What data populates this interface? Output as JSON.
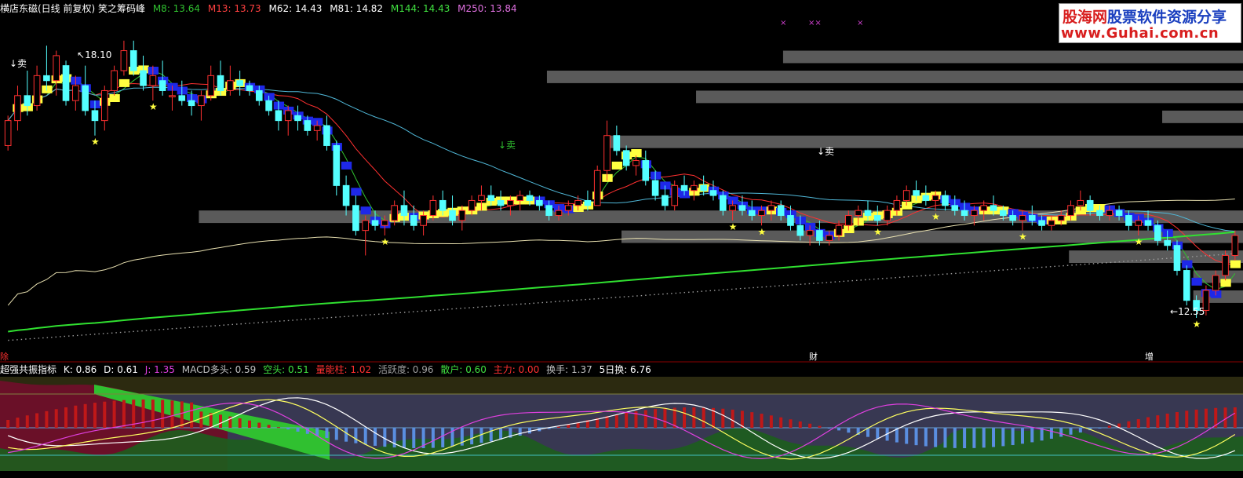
{
  "header": {
    "title": "横店东磁(日线 前复权) 笑之筹码峰",
    "ma": [
      {
        "label": "M8: 13.64",
        "color": "#30c030"
      },
      {
        "label": "M13: 13.73",
        "color": "#ff4040"
      },
      {
        "label": "M62: 14.43",
        "color": "#ffffff"
      },
      {
        "label": "M81: 14.82",
        "color": "#ffffff"
      },
      {
        "label": "M144: 14.43",
        "color": "#40e040"
      },
      {
        "label": "M250: 13.84",
        "color": "#e070e0"
      }
    ]
  },
  "indicator_header": {
    "name": "超强共振指标",
    "items": [
      {
        "label": "K: 0.86",
        "color": "#ffffff"
      },
      {
        "label": "D: 0.61",
        "color": "#ffffff"
      },
      {
        "label": "J: 1.35",
        "color": "#e040e0"
      },
      {
        "label": "MACD多头: 0.59",
        "color": "#c0c0c0"
      },
      {
        "label": "空头: 0.51",
        "color": "#40e040"
      },
      {
        "label": "量能柱: 1.02",
        "color": "#ff3030"
      },
      {
        "label": "活跃度: 0.96",
        "color": "#a0a0a0"
      },
      {
        "label": "散户: 0.60",
        "color": "#40e040"
      },
      {
        "label": "主力: 0.00",
        "color": "#ff3030"
      },
      {
        "label": "换手: 1.37",
        "color": "#c0c0c0"
      },
      {
        "label": "5日换: 6.76",
        "color": "#ffffff"
      }
    ]
  },
  "logo": {
    "line1_a": "股海网",
    "line1_b": "股票软件资源分享",
    "line2": "www.Guhai.com.cn"
  },
  "annotations": {
    "high": "18.10",
    "low": "12.55",
    "sell1": "↓卖",
    "sell2": "↓卖",
    "sell3": "↓卖",
    "event1": "财",
    "event2": "增",
    "event0": "除"
  },
  "colors": {
    "up": "#ff3030",
    "down": "#54ffff",
    "bg": "#000000",
    "divider": "#8b0000"
  },
  "chart_data": {
    "type": "candlestick",
    "title": "横店东磁(日线 前复权)",
    "ylim": [
      12.0,
      18.6
    ],
    "high_label": 18.1,
    "low_label": 12.55,
    "ohlc": [
      [
        16.0,
        16.6,
        15.9,
        16.5
      ],
      [
        16.5,
        17.2,
        16.3,
        17.0
      ],
      [
        17.0,
        17.5,
        16.6,
        16.8
      ],
      [
        16.8,
        17.6,
        16.7,
        17.4
      ],
      [
        17.4,
        18.0,
        17.1,
        17.3
      ],
      [
        17.3,
        17.9,
        17.0,
        17.8
      ],
      [
        17.6,
        17.7,
        16.8,
        16.9
      ],
      [
        16.9,
        17.4,
        16.7,
        17.2
      ],
      [
        17.2,
        17.6,
        16.6,
        16.7
      ],
      [
        16.7,
        16.9,
        16.2,
        16.5
      ],
      [
        16.5,
        17.2,
        16.3,
        17.1
      ],
      [
        17.1,
        17.6,
        17.0,
        17.5
      ],
      [
        17.5,
        18.1,
        17.4,
        17.9
      ],
      [
        17.9,
        18.1,
        17.4,
        17.5
      ],
      [
        17.5,
        17.8,
        17.1,
        17.2
      ],
      [
        17.2,
        17.6,
        16.9,
        17.4
      ],
      [
        17.3,
        17.7,
        17.0,
        17.1
      ],
      [
        17.0,
        17.2,
        16.7,
        17.0
      ],
      [
        17.0,
        17.3,
        16.8,
        16.9
      ],
      [
        16.9,
        17.1,
        16.6,
        16.8
      ],
      [
        16.8,
        17.1,
        16.5,
        17.0
      ],
      [
        17.0,
        17.6,
        16.9,
        17.4
      ],
      [
        17.4,
        17.7,
        17.0,
        17.1
      ],
      [
        17.1,
        17.6,
        17.0,
        17.3
      ],
      [
        17.3,
        17.5,
        17.0,
        17.2
      ],
      [
        17.2,
        17.3,
        17.0,
        17.1
      ],
      [
        17.1,
        17.2,
        16.8,
        16.9
      ],
      [
        16.9,
        17.0,
        16.6,
        16.7
      ],
      [
        16.7,
        16.9,
        16.3,
        16.5
      ],
      [
        16.5,
        16.8,
        16.2,
        16.7
      ],
      [
        16.6,
        16.8,
        16.3,
        16.5
      ],
      [
        16.5,
        16.6,
        16.2,
        16.3
      ],
      [
        16.3,
        16.5,
        16.1,
        16.4
      ],
      [
        16.4,
        16.6,
        15.9,
        16.0
      ],
      [
        16.0,
        16.1,
        15.0,
        15.2
      ],
      [
        15.2,
        15.4,
        14.6,
        14.8
      ],
      [
        14.8,
        15.0,
        14.2,
        14.3
      ],
      [
        14.3,
        14.6,
        13.8,
        14.5
      ],
      [
        14.5,
        14.7,
        14.3,
        14.4
      ],
      [
        14.4,
        14.6,
        14.2,
        14.5
      ],
      [
        14.5,
        14.9,
        14.4,
        14.8
      ],
      [
        14.8,
        15.1,
        14.4,
        14.6
      ],
      [
        14.6,
        14.8,
        14.3,
        14.4
      ],
      [
        14.4,
        14.7,
        14.2,
        14.6
      ],
      [
        14.6,
        15.0,
        14.5,
        14.9
      ],
      [
        14.9,
        15.1,
        14.6,
        14.7
      ],
      [
        14.7,
        15.0,
        14.4,
        14.5
      ],
      [
        14.5,
        14.8,
        14.3,
        14.7
      ],
      [
        14.7,
        15.0,
        14.6,
        14.9
      ],
      [
        14.9,
        15.2,
        14.7,
        15.0
      ],
      [
        15.0,
        15.2,
        14.8,
        14.9
      ],
      [
        14.9,
        15.1,
        14.7,
        14.8
      ],
      [
        14.8,
        15.0,
        14.6,
        14.9
      ],
      [
        14.9,
        15.1,
        14.7,
        15.0
      ],
      [
        15.0,
        15.1,
        14.8,
        14.9
      ],
      [
        14.9,
        15.0,
        14.7,
        14.8
      ],
      [
        14.8,
        14.9,
        14.5,
        14.6
      ],
      [
        14.6,
        14.8,
        14.5,
        14.7
      ],
      [
        14.7,
        14.9,
        14.6,
        14.8
      ],
      [
        14.8,
        15.0,
        14.7,
        14.9
      ],
      [
        14.9,
        15.1,
        14.7,
        14.8
      ],
      [
        14.8,
        15.6,
        14.8,
        15.5
      ],
      [
        15.5,
        16.5,
        15.3,
        16.2
      ],
      [
        16.2,
        16.4,
        15.8,
        15.9
      ],
      [
        15.9,
        16.0,
        15.5,
        15.6
      ],
      [
        15.6,
        15.8,
        15.4,
        15.7
      ],
      [
        15.7,
        15.9,
        15.2,
        15.3
      ],
      [
        15.3,
        15.5,
        14.9,
        15.0
      ],
      [
        15.0,
        15.2,
        14.7,
        14.8
      ],
      [
        14.8,
        15.3,
        14.7,
        15.2
      ],
      [
        15.2,
        15.4,
        15.0,
        15.1
      ],
      [
        15.1,
        15.3,
        14.9,
        15.2
      ],
      [
        15.2,
        15.4,
        15.0,
        15.1
      ],
      [
        15.1,
        15.3,
        14.9,
        15.0
      ],
      [
        15.0,
        15.1,
        14.6,
        14.7
      ],
      [
        14.7,
        14.9,
        14.5,
        14.8
      ],
      [
        14.8,
        15.0,
        14.6,
        14.7
      ],
      [
        14.7,
        14.9,
        14.5,
        14.6
      ],
      [
        14.6,
        14.8,
        14.4,
        14.7
      ],
      [
        14.7,
        14.9,
        14.5,
        14.8
      ],
      [
        14.8,
        14.9,
        14.5,
        14.6
      ],
      [
        14.6,
        14.8,
        14.3,
        14.4
      ],
      [
        14.4,
        14.6,
        14.1,
        14.2
      ],
      [
        14.2,
        14.4,
        14.0,
        14.3
      ],
      [
        14.3,
        14.5,
        14.0,
        14.1
      ],
      [
        14.1,
        14.3,
        14.0,
        14.2
      ],
      [
        14.2,
        14.5,
        14.1,
        14.4
      ],
      [
        14.4,
        14.7,
        14.3,
        14.6
      ],
      [
        14.6,
        14.8,
        14.4,
        14.7
      ],
      [
        14.7,
        14.9,
        14.5,
        14.6
      ],
      [
        14.6,
        14.8,
        14.4,
        14.5
      ],
      [
        14.5,
        14.8,
        14.4,
        14.7
      ],
      [
        14.7,
        15.0,
        14.6,
        14.9
      ],
      [
        14.9,
        15.2,
        14.8,
        15.1
      ],
      [
        15.1,
        15.3,
        14.9,
        15.0
      ],
      [
        15.0,
        15.2,
        14.8,
        14.9
      ],
      [
        14.9,
        15.1,
        14.7,
        15.0
      ],
      [
        15.0,
        15.1,
        14.7,
        14.8
      ],
      [
        14.8,
        15.0,
        14.6,
        14.7
      ],
      [
        14.7,
        14.9,
        14.5,
        14.6
      ],
      [
        14.6,
        14.8,
        14.4,
        14.7
      ],
      [
        14.7,
        14.9,
        14.5,
        14.8
      ],
      [
        14.8,
        15.0,
        14.6,
        14.7
      ],
      [
        14.7,
        14.8,
        14.5,
        14.6
      ],
      [
        14.6,
        14.7,
        14.4,
        14.5
      ],
      [
        14.5,
        14.7,
        14.3,
        14.6
      ],
      [
        14.6,
        14.8,
        14.4,
        14.5
      ],
      [
        14.5,
        14.6,
        14.3,
        14.4
      ],
      [
        14.4,
        14.6,
        14.3,
        14.5
      ],
      [
        14.5,
        14.7,
        14.4,
        14.6
      ],
      [
        14.6,
        14.9,
        14.5,
        14.8
      ],
      [
        14.8,
        15.1,
        14.7,
        14.9
      ],
      [
        14.9,
        15.0,
        14.6,
        14.7
      ],
      [
        14.7,
        14.8,
        14.5,
        14.6
      ],
      [
        14.6,
        14.8,
        14.5,
        14.7
      ],
      [
        14.7,
        14.8,
        14.5,
        14.6
      ],
      [
        14.6,
        14.7,
        14.3,
        14.4
      ],
      [
        14.4,
        14.6,
        14.2,
        14.5
      ],
      [
        14.5,
        14.7,
        14.3,
        14.4
      ],
      [
        14.4,
        14.5,
        14.0,
        14.1
      ],
      [
        14.1,
        14.3,
        13.9,
        14.0
      ],
      [
        14.0,
        14.1,
        13.4,
        13.5
      ],
      [
        13.5,
        13.6,
        12.8,
        12.9
      ],
      [
        12.9,
        13.0,
        12.55,
        12.7
      ],
      [
        12.7,
        13.2,
        12.6,
        13.1
      ],
      [
        13.1,
        13.5,
        13.0,
        13.4
      ],
      [
        13.4,
        13.9,
        13.3,
        13.8
      ],
      [
        13.8,
        14.3,
        13.7,
        14.2
      ]
    ],
    "volume_profile_bars": [
      {
        "y": [
          17.65,
          17.9
        ],
        "x0": 0.63
      },
      {
        "y": [
          17.25,
          17.5
        ],
        "x0": 0.44
      },
      {
        "y": [
          16.85,
          17.1
        ],
        "x0": 0.56
      },
      {
        "y": [
          16.45,
          16.7
        ],
        "x0": 0.935
      },
      {
        "y": [
          15.95,
          16.2
        ],
        "x0": 0.49
      },
      {
        "y": [
          14.45,
          14.7
        ],
        "x0": 0.16
      },
      {
        "y": [
          14.05,
          14.3
        ],
        "x0": 0.5
      },
      {
        "y": [
          13.65,
          13.9
        ],
        "x0": 0.86
      },
      {
        "y": [
          13.25,
          13.5
        ],
        "x0": 0.96
      },
      {
        "y": [
          12.85,
          13.1
        ],
        "x0": 0.96
      }
    ]
  }
}
